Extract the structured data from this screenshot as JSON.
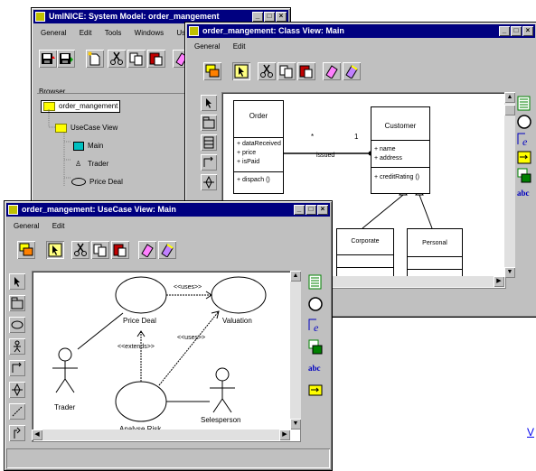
{
  "main_window": {
    "title": "UmlNICE: System Model: order_mangement",
    "menu": [
      "General",
      "Edit",
      "Tools",
      "Windows",
      "Us"
    ],
    "browser": {
      "label": "Browser",
      "root": "order_mangement",
      "items": [
        "UseCase View",
        "Main",
        "Trader",
        "Price Deal"
      ]
    }
  },
  "class_window": {
    "title": "order_mangement: Class View: Main",
    "menu": [
      "General",
      "Edit"
    ],
    "classes": {
      "order": {
        "name": "Order",
        "attributes": [
          "+ dataReceived",
          "+ price",
          "+ isPaid"
        ],
        "operations": [
          "+ dispach ()"
        ]
      },
      "customer": {
        "name": "Customer",
        "attributes": [
          "+ name",
          "+ address"
        ],
        "operations": [
          "+ creditRating ()"
        ]
      },
      "corporate": {
        "name": "Corporate"
      },
      "personal": {
        "name": "Personal"
      }
    },
    "association": {
      "label": "issued",
      "mult_left": "*",
      "mult_right": "1"
    }
  },
  "usecase_window": {
    "title": "order_mangement: UseCase View: Main",
    "menu": [
      "General",
      "Edit"
    ],
    "usecases": {
      "price_deal": "Price Deal",
      "valuation": "Valuation",
      "analyse_risk": "Analyse Risk"
    },
    "actors": {
      "trader": "Trader",
      "salesperson": "Selesperson"
    },
    "relations": {
      "uses1": "<<uses>>",
      "uses2": "<<uses>>",
      "extends": "<<extends>>"
    }
  },
  "link_text": "V",
  "window_buttons": {
    "minimize": "_",
    "maximize": "□",
    "close": "×"
  },
  "palette": {
    "text_tool": "abc",
    "note_tool": "NOTE"
  },
  "colors": {
    "titlebar": "#000080",
    "face": "#c0c0c0",
    "folder": "#ffff00"
  }
}
